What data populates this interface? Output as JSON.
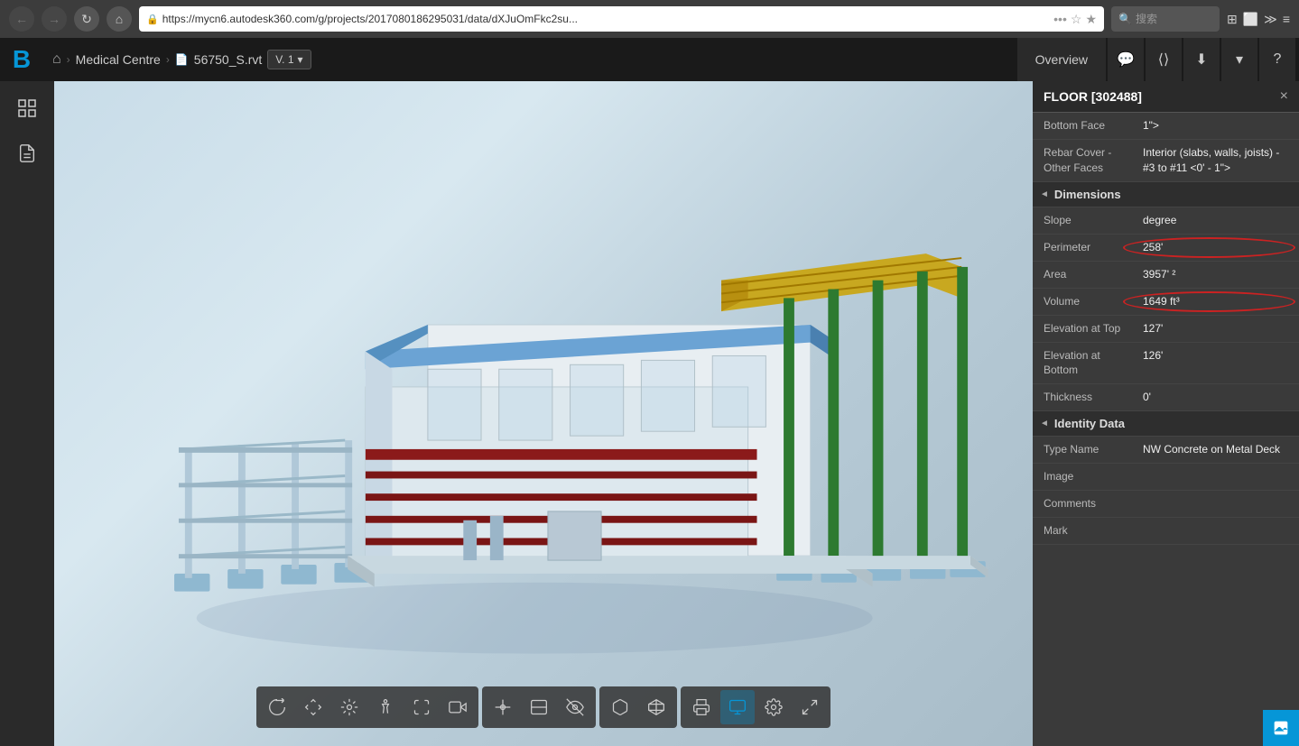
{
  "browser": {
    "url": "https://mycn6.autodesk360.com/g/projects/2017080186295031/data/dXJuOmFkc2su...",
    "search_placeholder": "搜索"
  },
  "header": {
    "logo": "B",
    "breadcrumb": {
      "home_icon": "⌂",
      "medical_centre": "Medical Centre",
      "file_name": "56750_S.rvt",
      "version": "V. 1"
    },
    "overview_label": "Overview",
    "actions": [
      "💬",
      "⟨⟩",
      "⬇",
      "∨",
      "?"
    ]
  },
  "left_sidebar": {
    "icons": [
      "cube",
      "document"
    ]
  },
  "toolbar": {
    "groups": [
      {
        "id": "navigation",
        "buttons": [
          "orbit",
          "pan",
          "freeorbit",
          "walk",
          "fly",
          "fit"
        ]
      },
      {
        "id": "measure",
        "buttons": [
          "measure",
          "section",
          "hide"
        ]
      },
      {
        "id": "model",
        "buttons": [
          "model-browser",
          "model-tree"
        ]
      },
      {
        "id": "render",
        "buttons": [
          "render",
          "active-btn",
          "settings",
          "fullscreen"
        ]
      }
    ]
  },
  "right_panel": {
    "title": "FLOOR [302488]",
    "close_label": "×",
    "sections": [
      {
        "id": "constraints",
        "properties": [
          {
            "label": "Bottom Face",
            "value": "1\">"
          },
          {
            "label": "Rebar Cover - Other Faces",
            "value": "Interior (slabs, walls, joists) - #3 to #11 <0' - 1\">"
          }
        ]
      },
      {
        "id": "dimensions",
        "title": "Dimensions",
        "collapsed": false,
        "properties": [
          {
            "label": "Slope",
            "value": "degree"
          },
          {
            "label": "Perimeter",
            "value": "258'",
            "highlighted": true
          },
          {
            "label": "Area",
            "value": "3957' ²"
          },
          {
            "label": "Volume",
            "value": "1649 ft³",
            "highlighted": true
          },
          {
            "label": "Elevation at Top",
            "value": "127'"
          },
          {
            "label": "Elevation at Bottom",
            "value": "126'"
          },
          {
            "label": "Thickness",
            "value": "0'"
          }
        ]
      },
      {
        "id": "identity-data",
        "title": "Identity Data",
        "collapsed": false,
        "properties": [
          {
            "label": "Type Name",
            "value": "NW Concrete on Metal Deck"
          },
          {
            "label": "Image",
            "value": ""
          },
          {
            "label": "Comments",
            "value": ""
          },
          {
            "label": "Mark",
            "value": ""
          }
        ]
      }
    ]
  }
}
